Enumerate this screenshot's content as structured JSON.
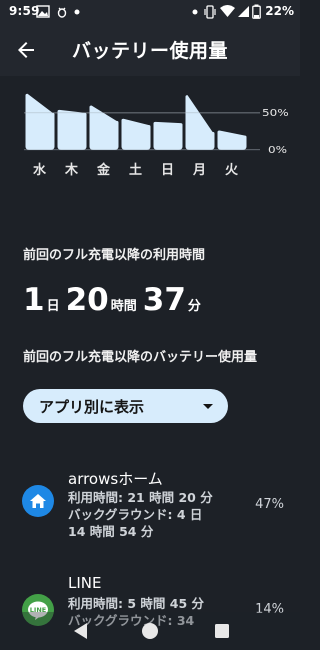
{
  "status_bar": {
    "time": "9:59",
    "battery_percent": "22%",
    "left_icons": [
      "image-icon",
      "bug-icon",
      "dot-icon"
    ],
    "right_icons": [
      "dot-icon",
      "vibrate-icon",
      "wifi-icon",
      "signal-icon",
      "battery-icon"
    ]
  },
  "app_bar": {
    "title": "バッテリー使用量"
  },
  "chart_data": {
    "type": "area",
    "categories": [
      "水",
      "木",
      "金",
      "土",
      "日",
      "月",
      "火"
    ],
    "values": [
      76,
      54,
      60,
      42,
      36,
      74,
      26
    ],
    "y_ticks": [
      "50%",
      "0%"
    ],
    "ylim": [
      0,
      100
    ],
    "grid": true,
    "color": "#d7ecfc"
  },
  "last_full_charge": {
    "usage_label": "前回のフル充電以降の利用時間",
    "days_value": "1",
    "days_unit": "日",
    "hours_value": "20",
    "hours_unit": "時間",
    "minutes_value": "37",
    "minutes_unit": "分",
    "battery_label": "前回のフル充電以降のバッテリー使用量"
  },
  "view_selector": {
    "label": "アプリ別に表示"
  },
  "apps": [
    {
      "name": "arrowsホーム",
      "detail_line1": "利用時間: 21 時間 20 分",
      "detail_line2": "バックグラウンド: 4 日",
      "detail_line3": "14 時間 54 分",
      "percent": "47%",
      "icon": "home-icon",
      "icon_color": "#1e88e5"
    },
    {
      "name": "LINE",
      "detail_line1": "利用時間: 5 時間 45 分",
      "detail_line2": "バックグラウンド: 34",
      "detail_line3": "",
      "percent": "14%",
      "icon": "line-icon",
      "icon_color": "#43a047"
    }
  ],
  "nav_bar": {
    "buttons": [
      "back-nav-icon",
      "home-nav-icon",
      "recents-nav-icon"
    ]
  }
}
